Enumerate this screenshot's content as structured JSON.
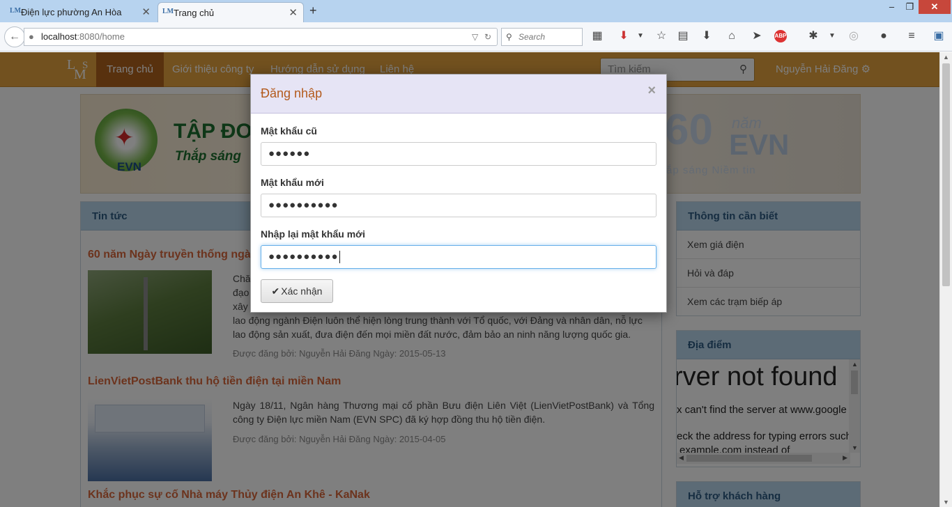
{
  "browser": {
    "tabs": [
      {
        "label": "Điện lực phường An Hòa",
        "active": false
      },
      {
        "label": "Trang chủ",
        "active": true
      }
    ],
    "new_tab_icon": "plus-icon",
    "url_host": "localhost",
    "url_rest": ":8080/home",
    "search_placeholder": "Search",
    "window_controls": [
      "minimize-icon",
      "maximize-icon",
      "close-icon"
    ],
    "toolbar_icons": [
      "grid-icon",
      "pocket-icon",
      "star-icon",
      "reading-list-icon",
      "download-icon",
      "home-icon",
      "send-icon",
      "adblock-icon",
      "bug-icon",
      "circle-icon",
      "chat-icon",
      "menu-icon",
      "sidebar-icon"
    ],
    "adblock_label": "ABP"
  },
  "site": {
    "logo": {
      "l": "L",
      "m": "M",
      "s": "S"
    },
    "menu": [
      {
        "label": "Trang chủ",
        "active": true
      },
      {
        "label": "Giới thiệu công ty",
        "active": false
      },
      {
        "label": "Hướng dẫn sử dụng",
        "active": false
      },
      {
        "label": "Liên hệ",
        "active": false
      }
    ],
    "search_placeholder": "Tìm kiếm",
    "user_name": "Nguyễn Hải Đăng",
    "accent_color": "#e5a23e",
    "active_menu_color": "#b1621d"
  },
  "banner": {
    "title": "TẬP ĐO",
    "slogan": "Thắp sáng",
    "logo_text": "EVN",
    "years": "60",
    "years_word": "năm",
    "brand": "EVN",
    "tagline": "ắp sáng Niềm tin"
  },
  "news": {
    "heading": "Tin tức",
    "articles": [
      {
        "title": "60 năm Ngày truyền thống ngà",
        "lines": [
          "Chă",
          "đạo",
          "xây",
          "lao động ngành Điện luôn thể hiện lòng trung thành với Tổ quốc, với Đảng và nhân dân, nỗ lực",
          "lao động sản xuất, đưa điện đến mọi miền đất nước, đảm bảo an ninh năng lượng quốc gia."
        ],
        "meta": "Được đăng bởi: Nguyễn Hải Đăng Ngày: 2015-05-13"
      },
      {
        "title": "LienVietPostBank thu hộ tiền điện tại miền Nam",
        "lines": [
          "Ngày 18/11, Ngân hàng Thương mại cổ phần Bưu điện Liên Việt (LienVietPostBank) và Tổng công ty Điện lực miền Nam (EVN SPC) đã ký hợp đồng thu hộ tiền điện."
        ],
        "meta": "Được đăng bởi: Nguyễn Hải Đăng Ngày: 2015-04-05"
      },
      {
        "title": "Khắc phục sự cố Nhà máy Thủy điện An Khê - KaNak",
        "lines": [],
        "meta": ""
      }
    ]
  },
  "sidebar": {
    "info": {
      "heading": "Thông tin cần biết",
      "items": [
        "Xem giá điện",
        "Hỏi và đáp",
        "Xem các trạm biếp áp"
      ]
    },
    "location": {
      "heading": "Địa điểm",
      "error_title": "rver not found",
      "error_line1": "x can't find the server at www.google",
      "error_line2": "eck the address for typing errors such",
      "error_line3": "example.com instead of"
    },
    "support": {
      "heading": "Hỗ trợ khách hàng"
    }
  },
  "modal": {
    "title": "Đăng nhập",
    "close_label": "×",
    "fields": [
      {
        "label": "Mật khẩu cũ",
        "value": "●●●●●●"
      },
      {
        "label": "Mật khẩu mới",
        "value": "●●●●●●●●●●"
      },
      {
        "label": "Nhập lại mật khẩu mới",
        "value": "●●●●●●●●●●"
      }
    ],
    "confirm_label": "Xác nhận",
    "confirm_icon": "check-icon"
  }
}
